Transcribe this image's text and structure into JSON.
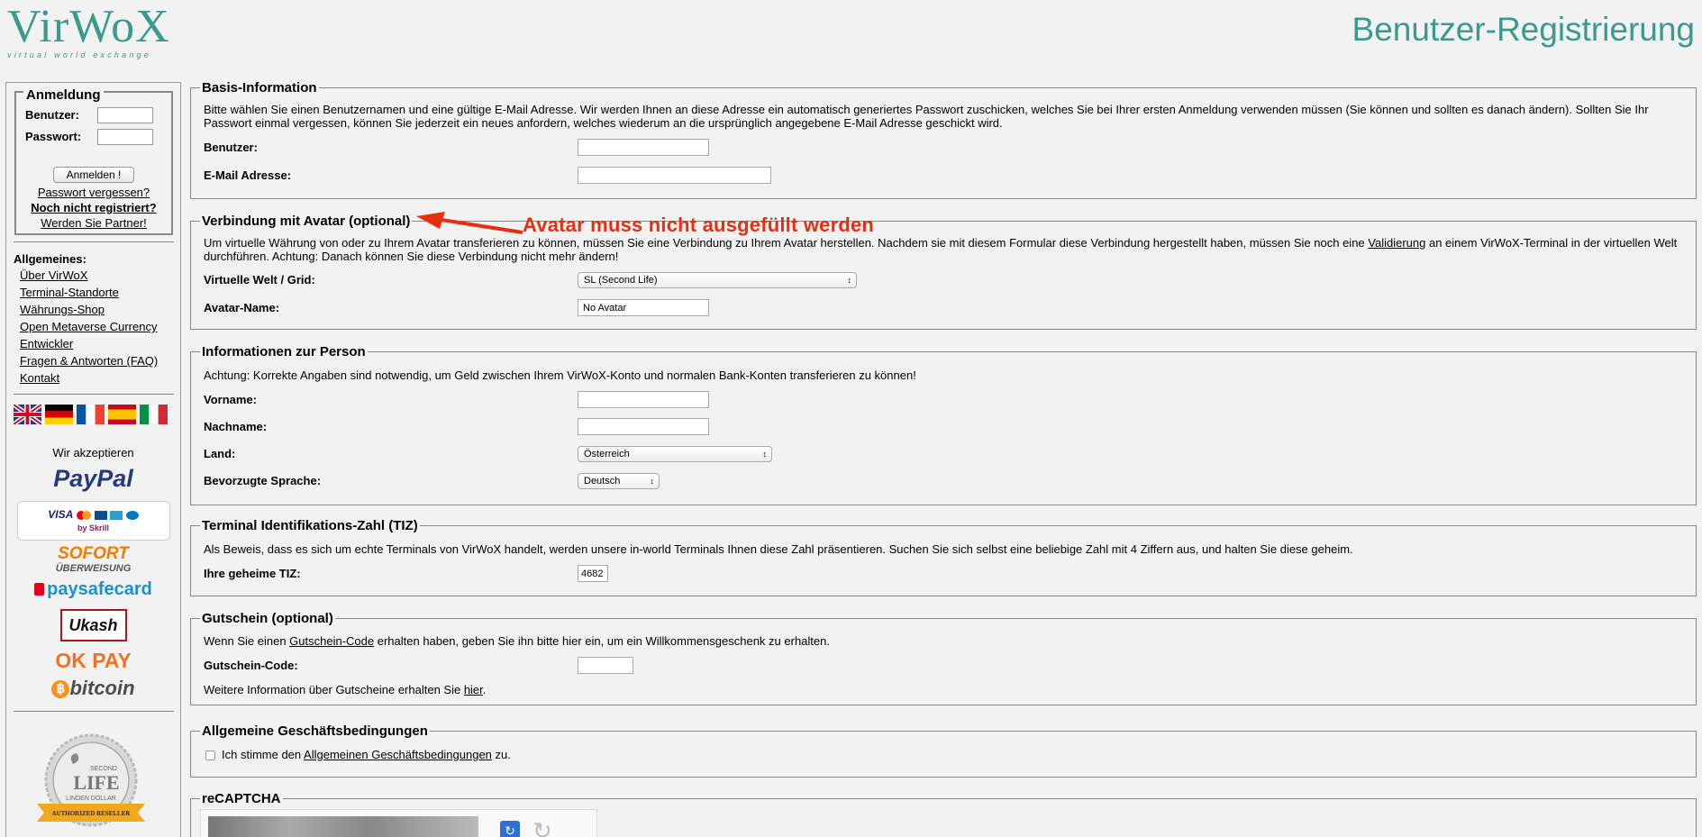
{
  "header": {
    "logo_word": "VirWoX",
    "logo_tagline": "virtual world exchange",
    "page_title": "Benutzer-Registrierung"
  },
  "sidebar": {
    "login": {
      "title": "Anmeldung",
      "user_label": "Benutzer:",
      "password_label": "Passwort:",
      "login_button": "Anmelden !",
      "forgot_password": "Passwort vergessen?",
      "not_registered": "Noch nicht registriert?",
      "become_partner": "Werden Sie Partner!"
    },
    "general_title": "Allgemeines:",
    "nav": [
      "Über VirWoX",
      "Terminal-Standorte",
      "Währungs-Shop",
      "Open Metaverse Currency",
      "Entwickler",
      "Fragen & Antworten (FAQ)",
      "Kontakt"
    ],
    "flags": [
      "flag-uk-icon",
      "flag-germany-icon",
      "flag-france-icon",
      "flag-spain-icon",
      "flag-italy-icon"
    ],
    "we_accept": "Wir akzeptieren",
    "payments": {
      "paypal": "PayPal",
      "skrill_cards": "VISA",
      "skrill_by": "by Skrill",
      "sofort": "SOFORT",
      "sofort_sub": "ÜBERWEISUNG",
      "paysafe": "paysafecard",
      "ukash": "Ukash",
      "okpay": "OK PAY",
      "bitcoin": "bitcoin"
    },
    "seal": {
      "second": "SECOND",
      "life": "LIFE",
      "linden": "LINDEN DOLLAR",
      "authorized": "AUTHORIZED RESELLER"
    }
  },
  "sections": {
    "basis": {
      "legend": "Basis-Information",
      "desc": "Bitte wählen Sie einen Benutzernamen und eine gültige E-Mail Adresse. Wir werden Ihnen an diese Adresse ein automatisch generiertes Passwort zuschicken, welches Sie bei Ihrer ersten Anmeldung verwenden müssen (Sie können und sollten es danach ändern). Sollten Sie Ihr Passwort einmal vergessen, können Sie jederzeit ein neues anfordern, welches wiederum an die ursprünglich angegebene E-Mail Adresse geschickt wird.",
      "user_label": "Benutzer:",
      "email_label": "E-Mail Adresse:"
    },
    "avatar": {
      "legend": "Verbindung mit Avatar (optional)",
      "desc_before": "Um virtuelle Währung von oder zu Ihrem Avatar transferieren zu können, müssen Sie eine Verbindung zu Ihrem Avatar herstellen. Nachdem sie mit diesem Formular diese Verbindung hergestellt haben, müssen Sie noch eine ",
      "desc_link": "Validierung",
      "desc_after": " an einem VirWoX-Terminal in der virtuellen Welt durchführen. Achtung: Danach können Sie diese Verbindung nicht mehr ändern!",
      "world_label": "Virtuelle Welt / Grid:",
      "world_value": "SL (Second Life)",
      "name_label": "Avatar-Name:",
      "name_value": "No Avatar"
    },
    "person": {
      "legend": "Informationen zur Person",
      "desc": "Achtung: Korrekte Angaben sind notwendig, um Geld zwischen Ihrem VirWoX-Konto und normalen Bank-Konten transferieren zu können!",
      "firstname_label": "Vorname:",
      "lastname_label": "Nachname:",
      "country_label": "Land:",
      "country_value": "Österreich",
      "language_label": "Bevorzugte Sprache:",
      "language_value": "Deutsch"
    },
    "tiz": {
      "legend": "Terminal Identifikations-Zahl (TIZ)",
      "desc": "Als Beweis, dass es sich um echte Terminals von VirWoX handelt, werden unsere in-world Terminals Ihnen diese Zahl präsentieren. Suchen Sie sich selbst eine beliebige Zahl mit 4 Ziffern aus, und halten Sie diese geheim.",
      "label": "Ihre geheime TIZ:",
      "value": "4682"
    },
    "voucher": {
      "legend": "Gutschein (optional)",
      "desc_before": "Wenn Sie einen ",
      "desc_link": "Gutschein-Code",
      "desc_after": " erhalten haben, geben Sie ihn bitte hier ein, um ein Willkommensgeschenk zu erhalten.",
      "label": "Gutschein-Code:",
      "more_before": "Weitere Information über Gutscheine erhalten Sie ",
      "more_link": "hier",
      "more_after": "."
    },
    "terms": {
      "legend": "Allgemeine Geschäftsbedingungen",
      "text_before": "Ich stimme den ",
      "text_link": "Allgemeinen Geschäftsbedingungen",
      "text_after": " zu."
    },
    "captcha": {
      "legend": "reCAPTCHA"
    }
  },
  "annotation": {
    "text": "Avatar muss nicht ausgefüllt werden",
    "color": "#e82e10"
  }
}
